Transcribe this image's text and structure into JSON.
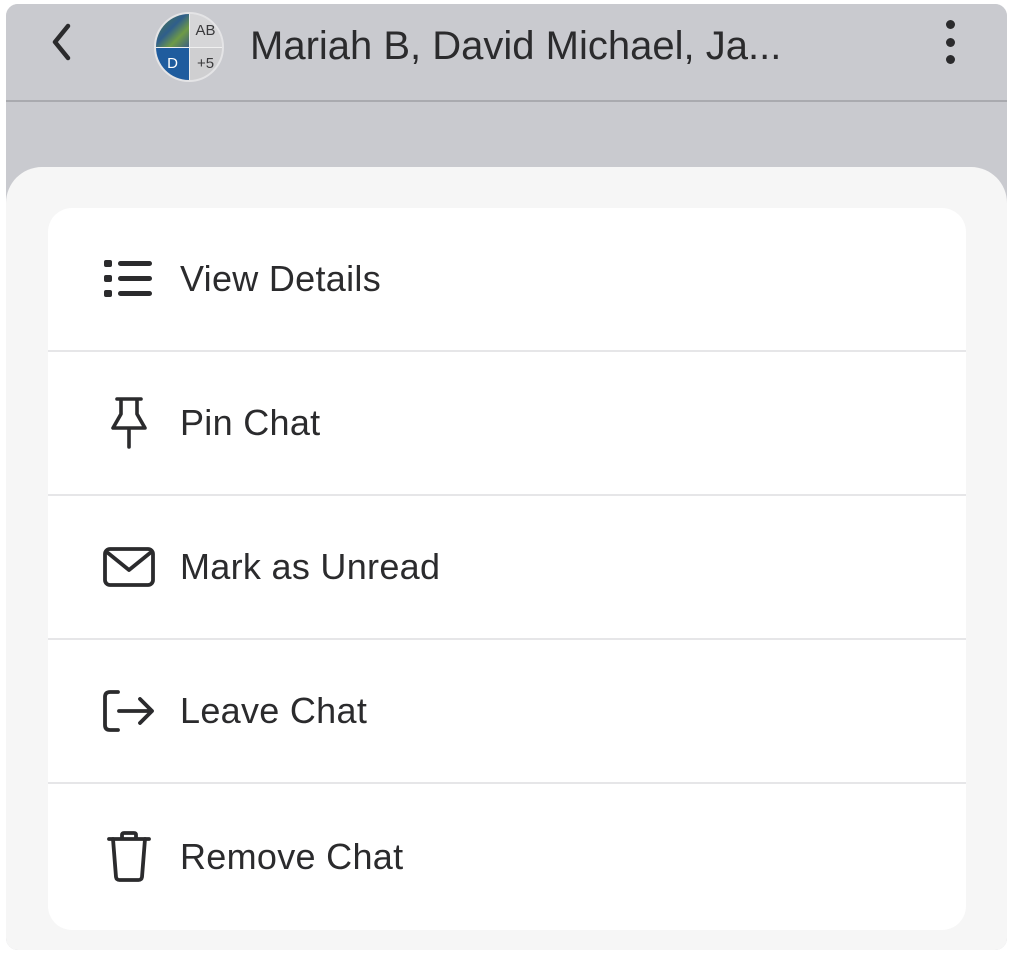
{
  "header": {
    "title": "Mariah B, David Michael, Ja...",
    "avatar": {
      "initials_top_right": "AB",
      "initials_bottom_left": "D",
      "extra_count": "+5"
    },
    "back_icon": "chevron-left-icon",
    "more_icon": "vertical-ellipsis-icon"
  },
  "menu": {
    "items": [
      {
        "label": "View Details",
        "icon": "list-icon"
      },
      {
        "label": "Pin Chat",
        "icon": "pin-icon"
      },
      {
        "label": "Mark as Unread",
        "icon": "envelope-icon"
      },
      {
        "label": "Leave Chat",
        "icon": "leave-icon"
      },
      {
        "label": "Remove Chat",
        "icon": "trash-icon"
      }
    ]
  },
  "colors": {
    "header_background": "#c9cacf",
    "sheet_background": "#f6f6f6",
    "card_background": "#ffffff",
    "text": "#2b2b2d",
    "avatar_blue": "#1f5c9e"
  }
}
